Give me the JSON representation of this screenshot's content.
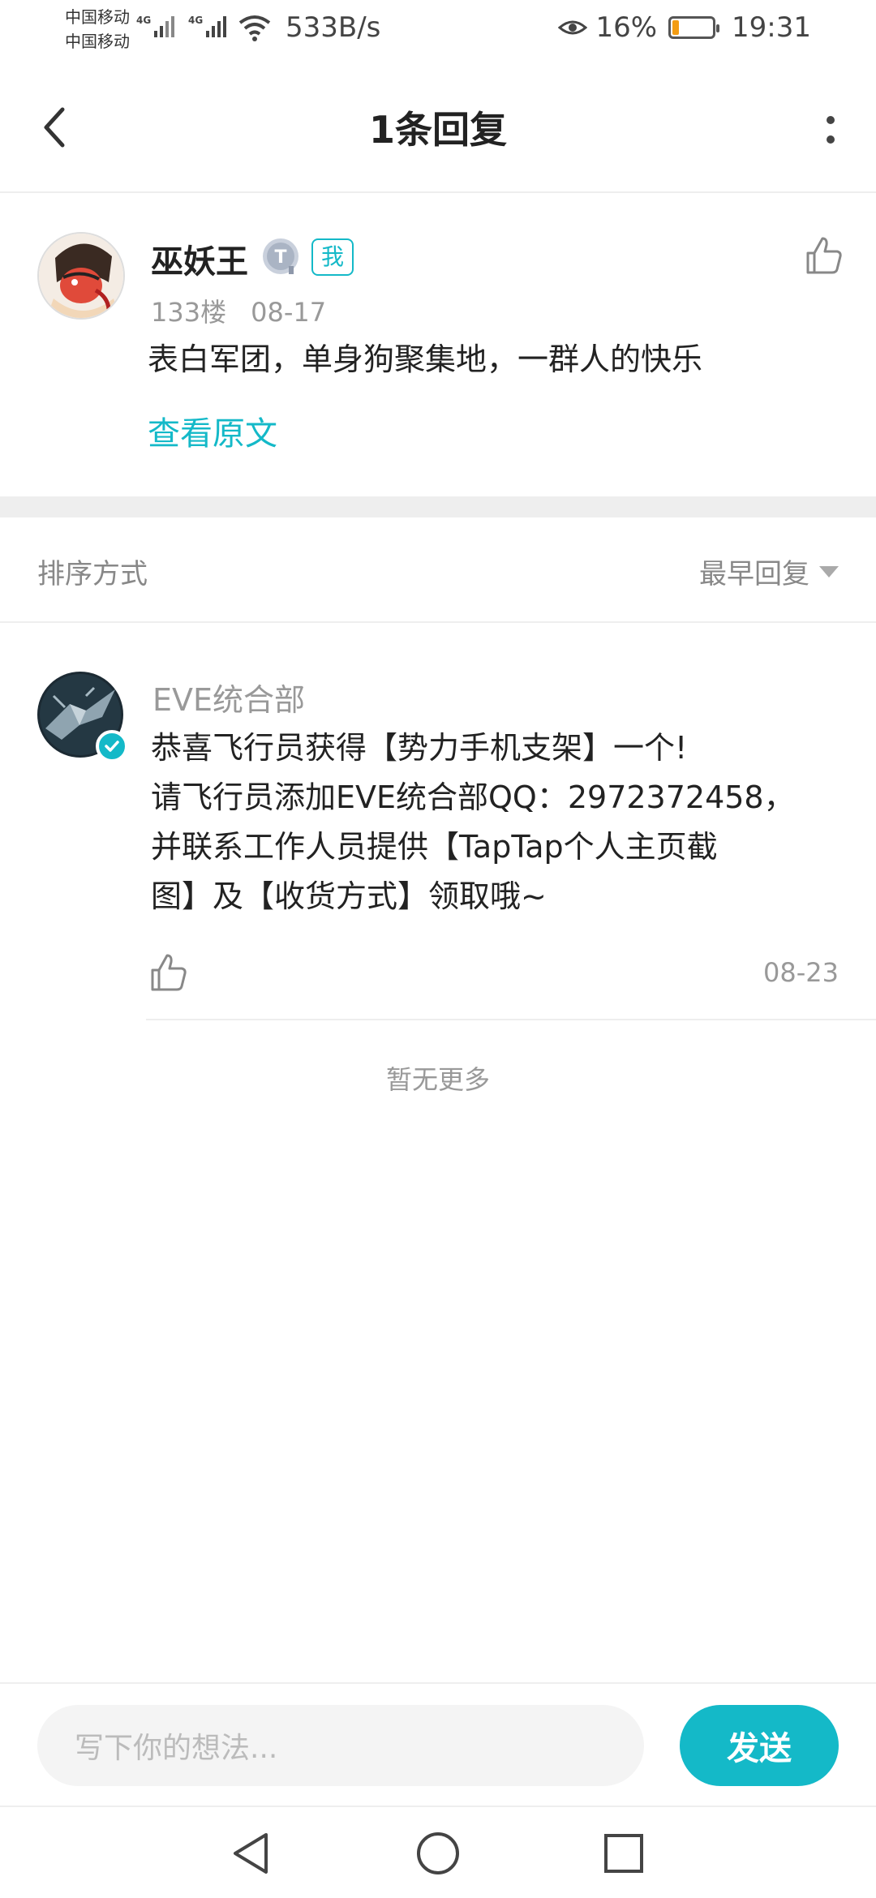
{
  "status_bar": {
    "carrier_1": "中国移动",
    "carrier_2": "中国移动",
    "network_1": "4G",
    "network_2": "4G",
    "speed": "533B/s",
    "battery_percent": "16%",
    "battery_level": 0.16,
    "time": "19:31"
  },
  "header": {
    "title": "1条回复"
  },
  "original_comment": {
    "author": "巫妖王",
    "level_badge": "T",
    "me_badge": "我",
    "floor": "133楼",
    "date": "08-17",
    "text": "表白军团，单身狗聚集地，一群人的快乐",
    "view_original": "查看原文"
  },
  "sort": {
    "label": "排序方式",
    "selected": "最早回复"
  },
  "reply": {
    "author": "EVE统合部",
    "lines": [
      "恭喜飞行员获得【势力手机支架】一个!",
      "请飞行员添加EVE统合部QQ：2972372458，",
      "并联系工作人员提供【TapTap个人主页截",
      "图】及【收货方式】领取哦~"
    ],
    "date": "08-23"
  },
  "no_more": "暂无更多",
  "composer": {
    "placeholder": "写下你的想法...",
    "send_label": "发送"
  },
  "colors": {
    "accent": "#14b9c8",
    "battery": "#f39c12"
  }
}
